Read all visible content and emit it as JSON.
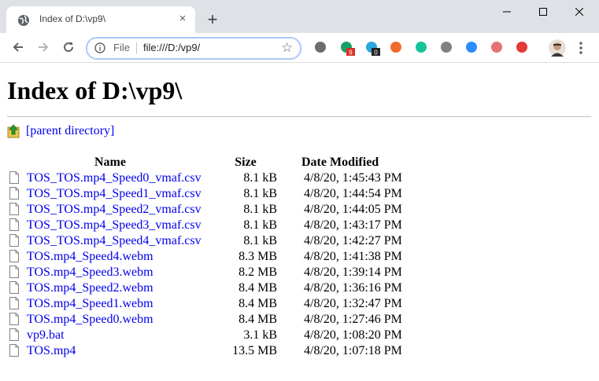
{
  "browser": {
    "tab_title": "Index of D:\\vp9\\",
    "tab_close": "×",
    "new_tab": "+",
    "address": {
      "scheme_label": "File",
      "url": "file:///D:/vp9/"
    },
    "star": "☆",
    "extensions": [
      {
        "name": "film-reel-icon",
        "color": "#6d6d6d"
      },
      {
        "name": "extension-g-icon",
        "color": "#1a9e6a",
        "badge": "9",
        "badge_color": "#d93025"
      },
      {
        "name": "extension-sync-icon",
        "color": "#2aa7dd",
        "badge": "0",
        "badge_color": "#202124"
      },
      {
        "name": "extension-b-icon",
        "color": "#f06a2c"
      },
      {
        "name": "grammarly-icon",
        "color": "#15c39a"
      },
      {
        "name": "extension-circle-icon",
        "color": "#808080"
      },
      {
        "name": "zoom-icon",
        "color": "#2d8cff"
      },
      {
        "name": "extension-record-icon",
        "color": "#e57373"
      },
      {
        "name": "youtube-icon",
        "color": "#e53935"
      }
    ]
  },
  "page": {
    "heading": "Index of D:\\vp9\\",
    "parent_link": "[parent directory]",
    "columns": {
      "name": "Name",
      "size": "Size",
      "date": "Date Modified"
    },
    "files": [
      {
        "name": "TOS_TOS.mp4_Speed0_vmaf.csv",
        "size": "8.1 kB",
        "date": "4/8/20, 1:45:43 PM"
      },
      {
        "name": "TOS_TOS.mp4_Speed1_vmaf.csv",
        "size": "8.1 kB",
        "date": "4/8/20, 1:44:54 PM"
      },
      {
        "name": "TOS_TOS.mp4_Speed2_vmaf.csv",
        "size": "8.1 kB",
        "date": "4/8/20, 1:44:05 PM"
      },
      {
        "name": "TOS_TOS.mp4_Speed3_vmaf.csv",
        "size": "8.1 kB",
        "date": "4/8/20, 1:43:17 PM"
      },
      {
        "name": "TOS_TOS.mp4_Speed4_vmaf.csv",
        "size": "8.1 kB",
        "date": "4/8/20, 1:42:27 PM"
      },
      {
        "name": "TOS.mp4_Speed4.webm",
        "size": "8.3 MB",
        "date": "4/8/20, 1:41:38 PM"
      },
      {
        "name": "TOS.mp4_Speed3.webm",
        "size": "8.2 MB",
        "date": "4/8/20, 1:39:14 PM"
      },
      {
        "name": "TOS.mp4_Speed2.webm",
        "size": "8.4 MB",
        "date": "4/8/20, 1:36:16 PM"
      },
      {
        "name": "TOS.mp4_Speed1.webm",
        "size": "8.4 MB",
        "date": "4/8/20, 1:32:47 PM"
      },
      {
        "name": "TOS.mp4_Speed0.webm",
        "size": "8.4 MB",
        "date": "4/8/20, 1:27:46 PM"
      },
      {
        "name": "vp9.bat",
        "size": "3.1 kB",
        "date": "4/8/20, 1:08:20 PM"
      },
      {
        "name": "TOS.mp4",
        "size": "13.5 MB",
        "date": "4/8/20, 1:07:18 PM"
      }
    ]
  },
  "colors": {
    "link": "#0000ee",
    "titlebar": "#dee1e6",
    "omnibox_focus": "#a8c7fa"
  }
}
